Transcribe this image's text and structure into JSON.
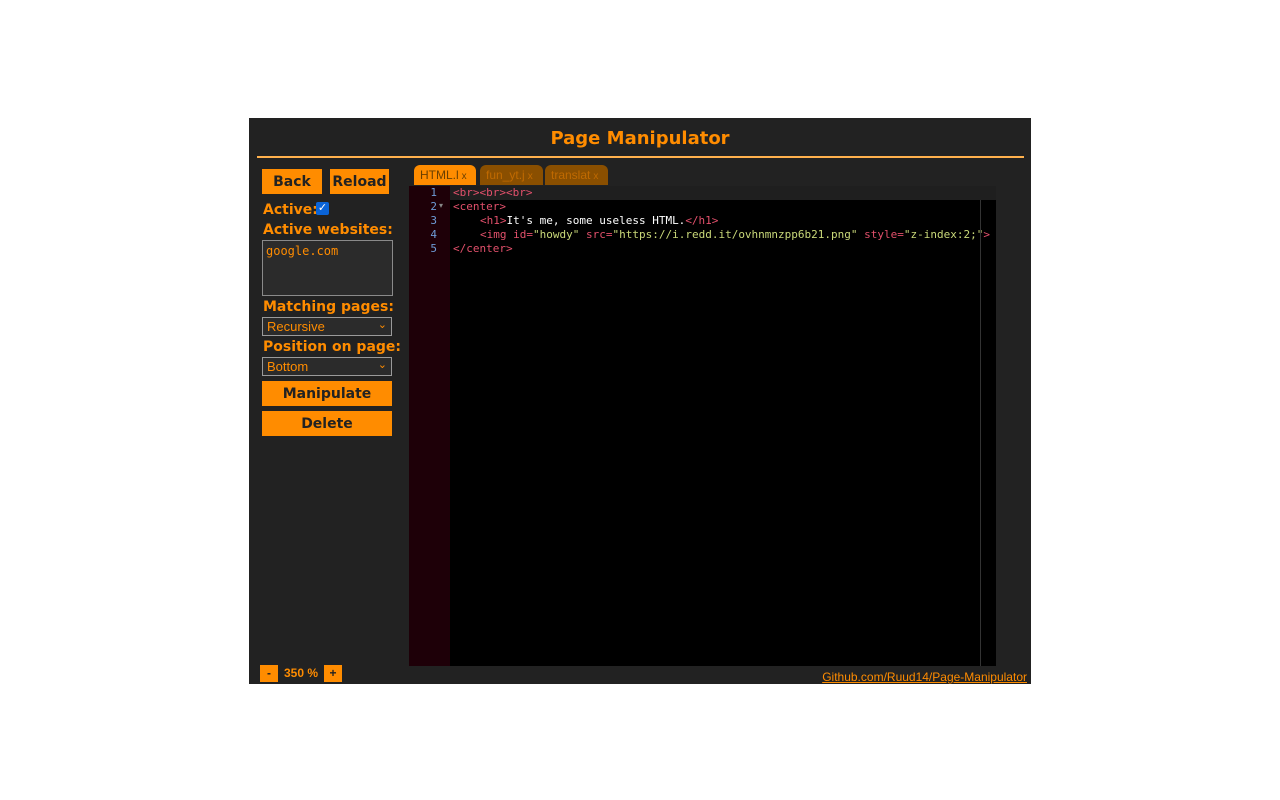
{
  "title": "Page Manipulator",
  "buttons": {
    "back": "Back",
    "reload": "Reload",
    "manipulate": "Manipulate",
    "delete": "Delete"
  },
  "labels": {
    "active": "Active:",
    "active_websites": "Active websites:",
    "matching_pages": "Matching pages:",
    "position_on_page": "Position on page:"
  },
  "active_checked": true,
  "active_websites_value": "google.com",
  "matching_pages_value": "Recursive",
  "position_value": "Bottom",
  "tabs": [
    {
      "label": "HTML.l",
      "close": "x"
    },
    {
      "label": "fun_yt.j",
      "close": "x"
    },
    {
      "label": "translat",
      "close": "x"
    }
  ],
  "editor": {
    "line_numbers": [
      "1",
      "2",
      "3",
      "4",
      "5"
    ],
    "l1": "<br><br><br>",
    "l2": "<center>",
    "l3_open": "<h1>",
    "l3_text": "It's me, some useless HTML.",
    "l3_close": "</h1>",
    "l4_open": "<img",
    "l4_a1": "id=",
    "l4_v1": "\"howdy\"",
    "l4_a2": "src=",
    "l4_v2": "\"https://i.redd.it/ovhnmnzpp6b21.png\"",
    "l4_a3": "style=",
    "l4_v3": "\"z-index:2;\"",
    "l4_close": ">",
    "l5": "</center>"
  },
  "zoom": {
    "minus": "-",
    "value": "350 %",
    "plus": "+"
  },
  "footer_link": "Github.com/Ruud14/Page-Manipulator",
  "colors": {
    "accent": "#ff8c00",
    "panel_bg": "#222222"
  }
}
